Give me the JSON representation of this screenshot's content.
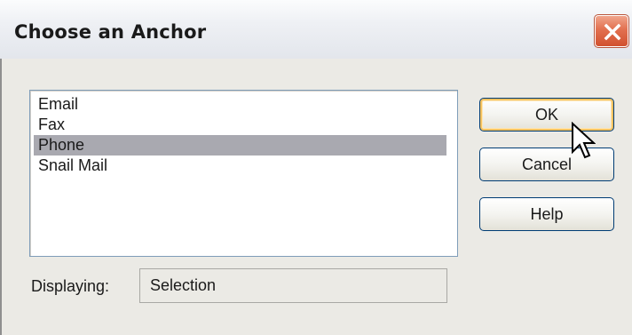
{
  "window": {
    "title": "Choose an Anchor",
    "close_icon": "close-x-icon",
    "accent_close": "#d1512f"
  },
  "listbox": {
    "items": [
      {
        "label": "Email",
        "selected": false
      },
      {
        "label": "Fax",
        "selected": false
      },
      {
        "label": "Phone",
        "selected": true
      },
      {
        "label": "Snail Mail",
        "selected": false
      }
    ],
    "selected_color": "#a9a9b0"
  },
  "displaying": {
    "label": "Displaying:",
    "value": "Selection"
  },
  "buttons": {
    "ok": "OK",
    "cancel": "Cancel",
    "help": "Help"
  },
  "cursor": {
    "icon": "arrow-pointer-icon"
  }
}
